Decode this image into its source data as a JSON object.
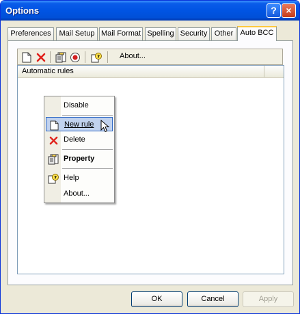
{
  "window": {
    "title": "Options",
    "help_glyph": "?",
    "close_glyph": "×"
  },
  "tabs": [
    {
      "label": "Preferences"
    },
    {
      "label": "Mail Setup"
    },
    {
      "label": "Mail Format"
    },
    {
      "label": "Spelling"
    },
    {
      "label": "Security"
    },
    {
      "label": "Other"
    },
    {
      "label": "Auto BCC",
      "active": true
    }
  ],
  "toolbar": {
    "icons": [
      "new-doc-icon",
      "delete-x-icon",
      "properties-icon",
      "record-icon",
      "help-icon"
    ],
    "about_label": "About..."
  },
  "list": {
    "column": "Automatic rules"
  },
  "context_menu": {
    "items": [
      {
        "label": "Disable",
        "icon": ""
      },
      {
        "label": "New rule",
        "icon": "new-doc-icon",
        "highlighted": true
      },
      {
        "label": "Delete",
        "icon": "delete-x-icon"
      },
      {
        "label": "Property",
        "icon": "properties-icon",
        "bold": true
      },
      {
        "label": "Help",
        "icon": "help-icon"
      },
      {
        "label": "About...",
        "icon": ""
      }
    ]
  },
  "buttons": {
    "ok": "OK",
    "cancel": "Cancel",
    "apply": "Apply"
  },
  "colors": {
    "title_bar": "#0054e3",
    "tab_highlight": "#ffc83c",
    "menu_highlight": "#c1d2ee",
    "delete_red": "#e0211b"
  }
}
